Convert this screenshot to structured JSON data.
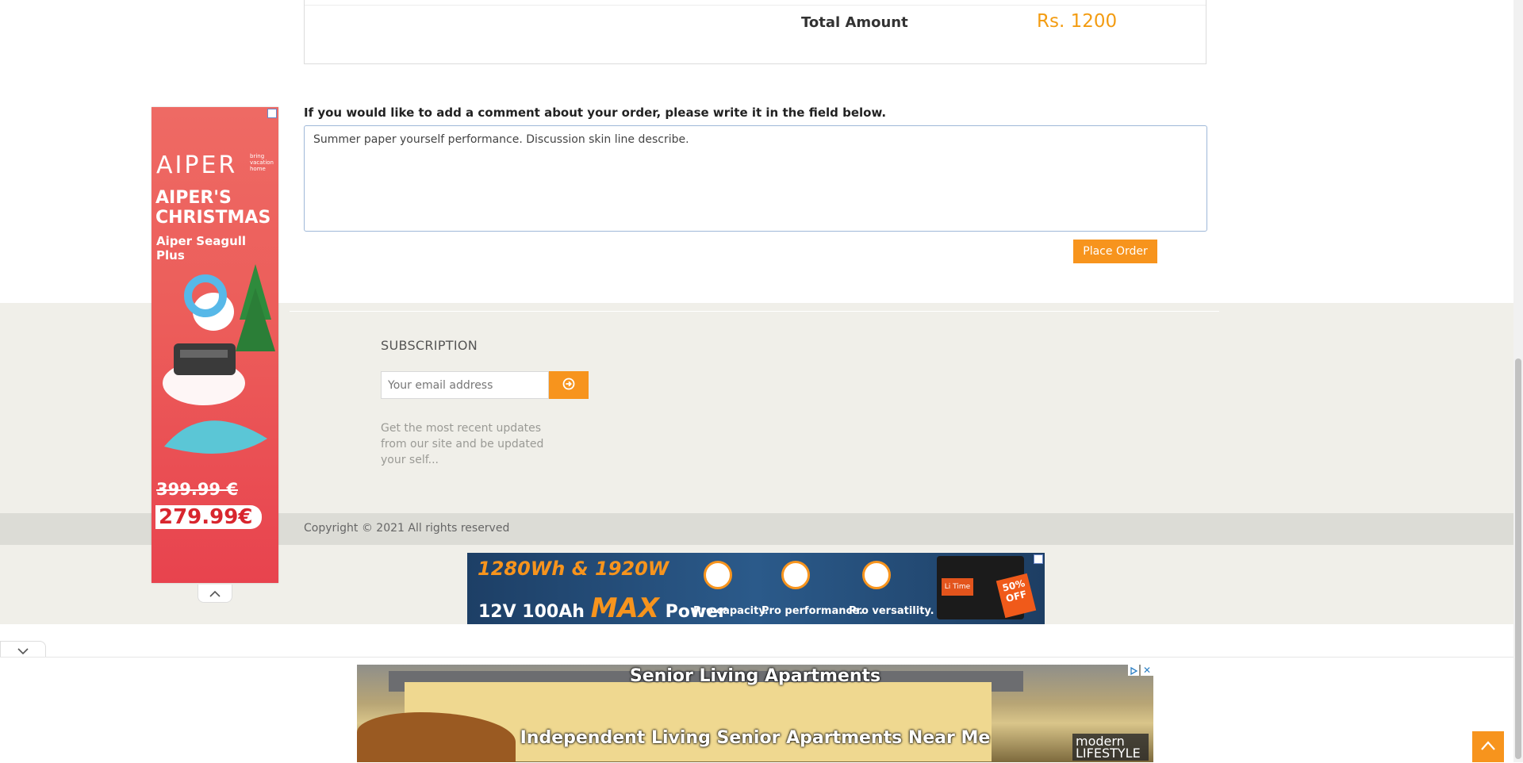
{
  "order": {
    "total_label": "Total Amount",
    "total_value": "Rs. 1200"
  },
  "comment": {
    "label": "If you would like to add a comment about your order, please write it in the field below.",
    "value": "Summer paper yourself performance. Discussion skin line describe."
  },
  "place_order_label": "Place Order",
  "subscription": {
    "title": "SUBSCRIPTION",
    "email_placeholder": "Your email address",
    "submit_icon": "arrow-circle-right-icon",
    "description": "Get the most recent updates from our site and be updated your self..."
  },
  "footer": {
    "copyright": "Copyright © 2021 All rights reserved"
  },
  "ads": {
    "side": {
      "brand": "AIPER",
      "brand_tag": "bring vacation home",
      "headline": "AIPER'S CHRISTMAS",
      "product": "Aiper Seagull Plus",
      "old_price": "399.99 €",
      "new_price": "279.99€"
    },
    "banner": {
      "line1": "1280Wh & 1920W",
      "line2_prefix": "12V 100Ah",
      "line2_max": "MAX",
      "line2_suffix": "Power",
      "features": [
        "Pro capacity.",
        "Pro performance.",
        "Pro versatility."
      ],
      "battery_label": "Li Time",
      "discount": "50% OFF"
    },
    "bottom": {
      "title": "Senior Living Apartments",
      "subtitle": "Independent Living Senior Apartments Near Me",
      "brand": "modern LIFESTYLE",
      "close_glyph": "✕"
    }
  },
  "colors": {
    "accent": "#f7941d",
    "footer_bg": "#f0efe9",
    "copyright_bg": "#dcdcd6"
  }
}
